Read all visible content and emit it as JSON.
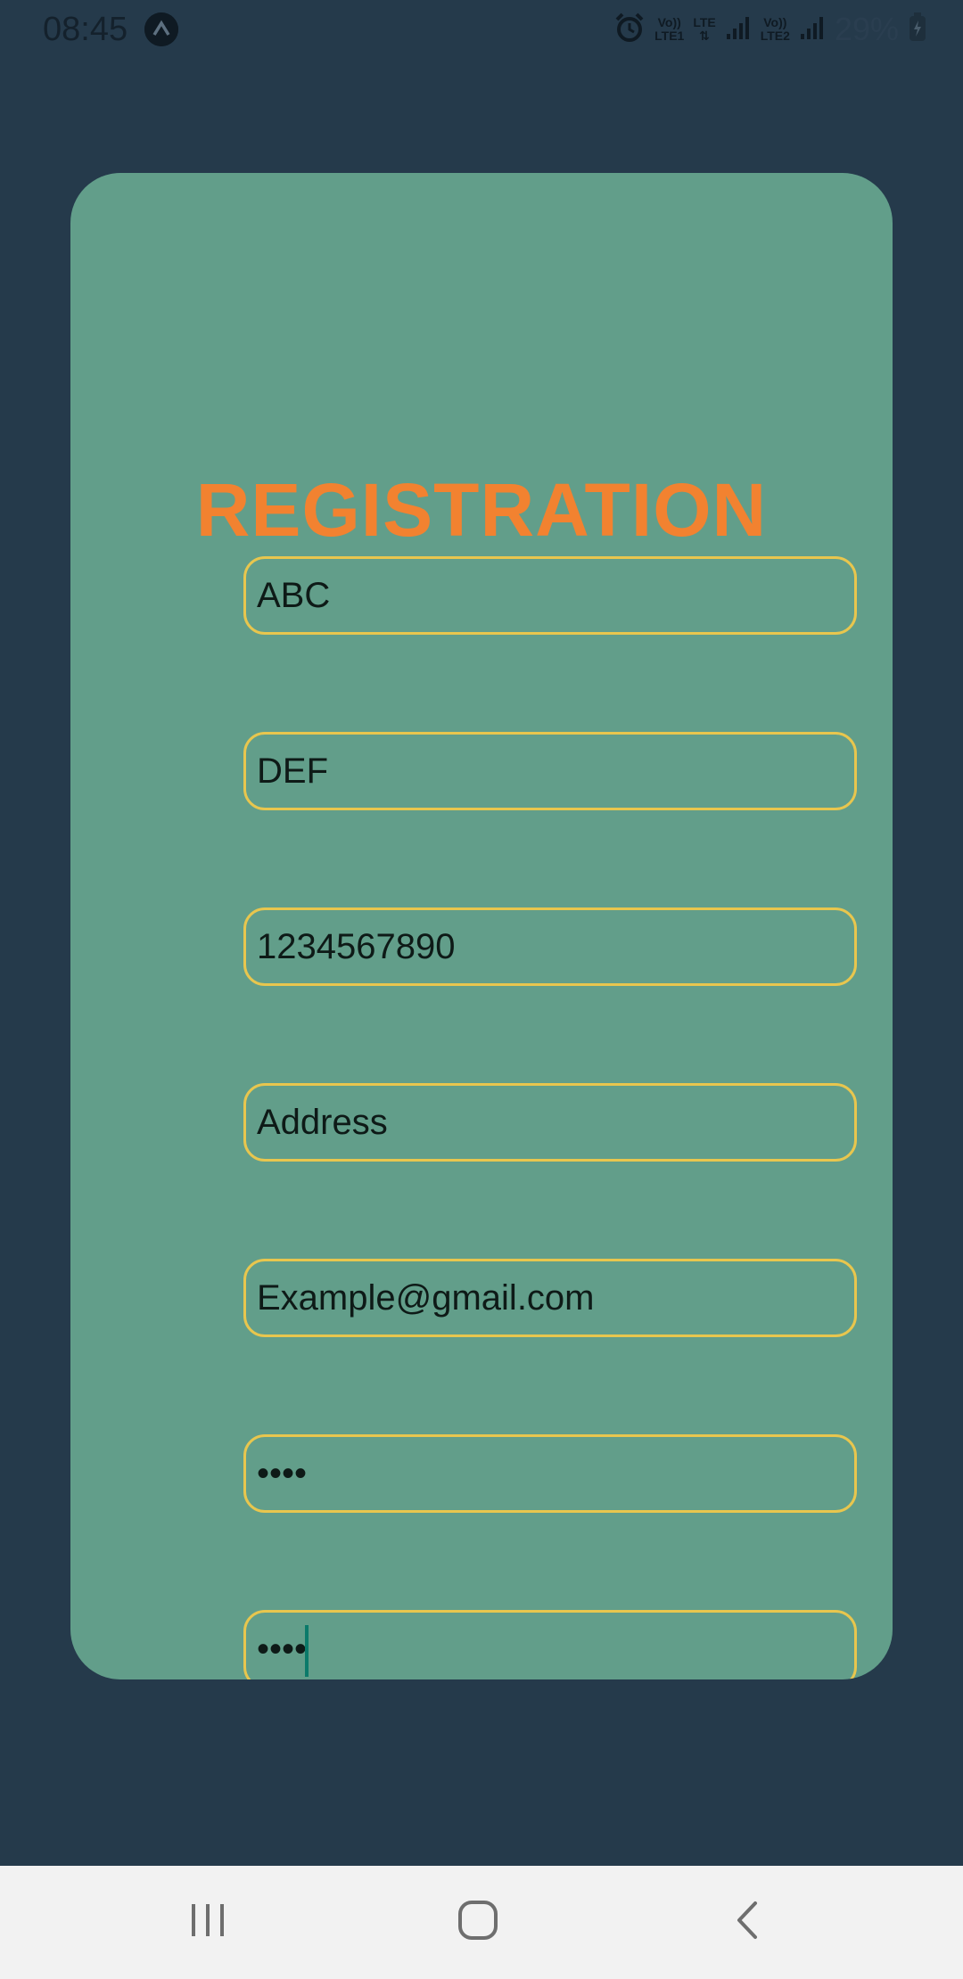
{
  "status_bar": {
    "time": "08:45",
    "app_icon": "app-notification-icon",
    "alarm_icon": "alarm-icon",
    "sim1_label_top": "Vo))",
    "sim1_label_bottom": "LTE1",
    "data_label": "LTE",
    "sim2_label_top": "Vo))",
    "sim2_label_bottom": "LTE2",
    "battery_percent": "29%",
    "battery_icon": "battery-charging-icon"
  },
  "form": {
    "title": "REGISTRATION",
    "fields": [
      {
        "value": "ABC"
      },
      {
        "value": "DEF"
      },
      {
        "value": "1234567890"
      },
      {
        "value": "Address"
      },
      {
        "value": "Example@gmail.com"
      },
      {
        "value": "••••"
      },
      {
        "value": "••••"
      }
    ]
  },
  "colors": {
    "background": "#253a4b",
    "card": "#629e8a",
    "title": "#f28230",
    "field_border": "#e8c64e"
  },
  "nav_bar": {
    "recents_icon": "recents-icon",
    "home_icon": "home-icon",
    "back_icon": "back-icon"
  }
}
